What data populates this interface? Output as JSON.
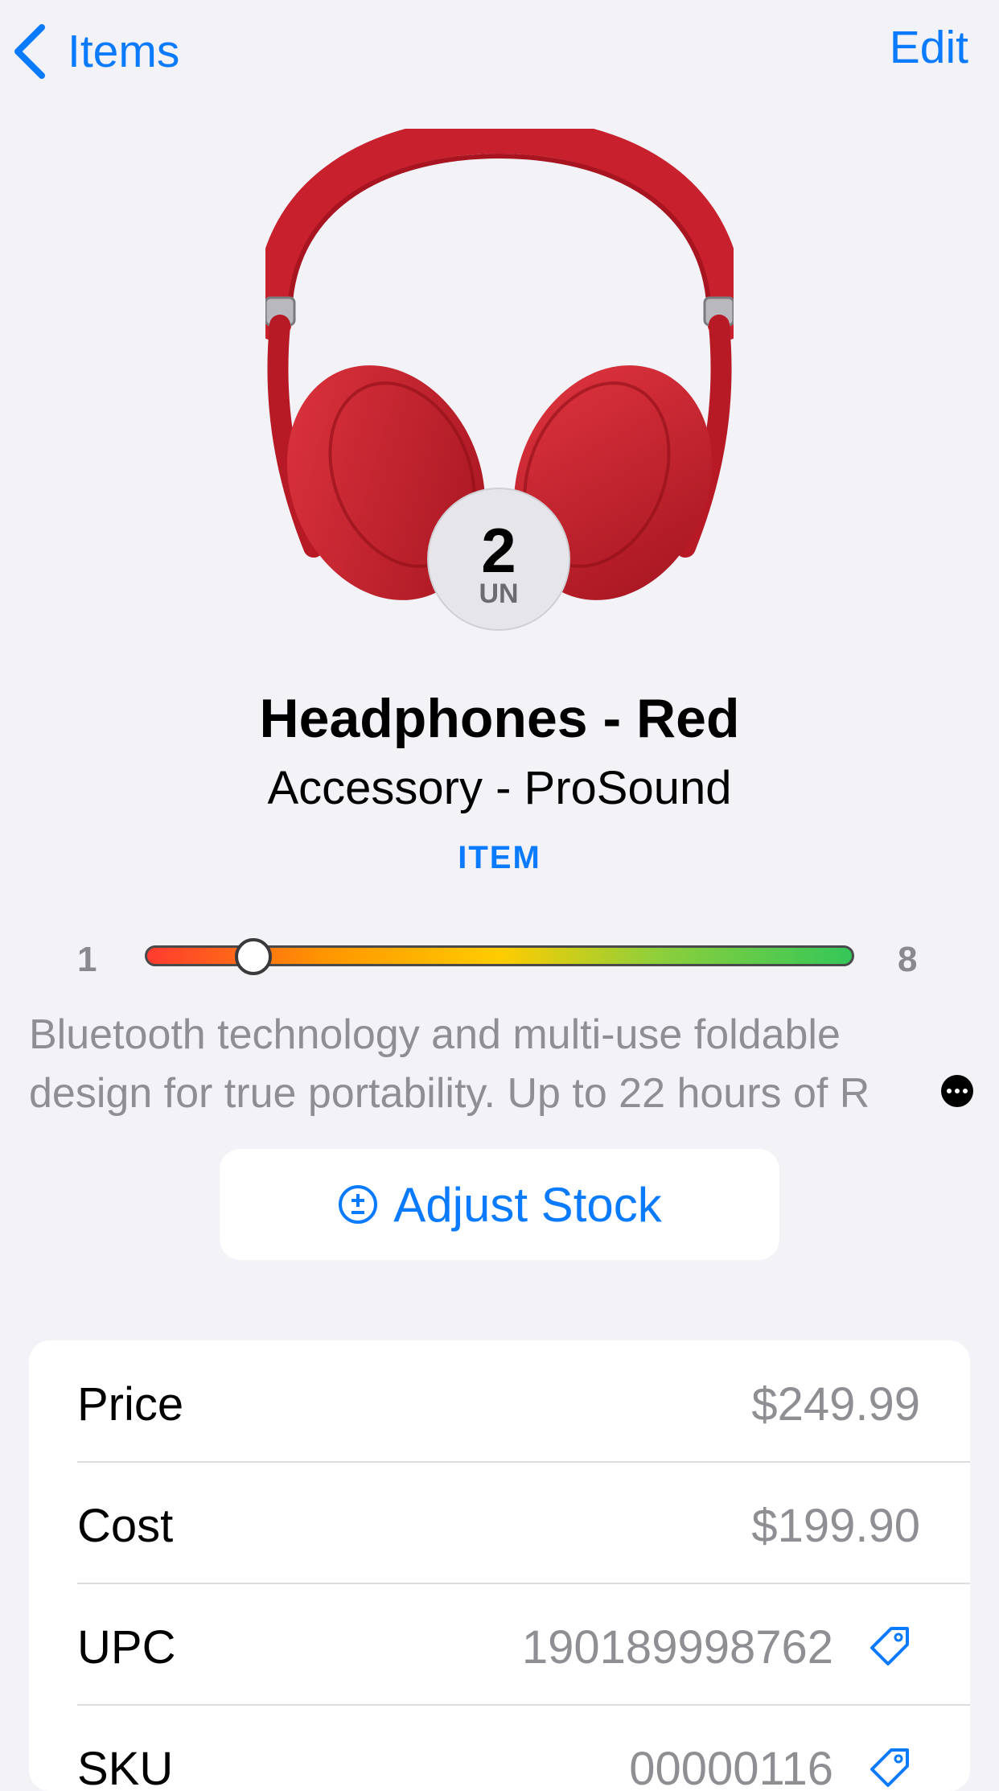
{
  "nav": {
    "back_label": "Items",
    "edit_label": "Edit"
  },
  "product": {
    "stock_qty": "2",
    "stock_unit": "UN",
    "name": "Headphones - Red",
    "category": "Accessory - ProSound",
    "type": "ITEM",
    "image_icon": "headphones-image"
  },
  "stock_slider": {
    "min": "1",
    "max": "8",
    "value": 2
  },
  "description": "Bluetooth technology and multi-use foldable design for true portability.  Up to 22 hours of R",
  "adjust": {
    "label": "Adjust Stock",
    "icon": "plus-minus-circle-icon"
  },
  "details": [
    {
      "label": "Price",
      "value": "$249.99",
      "icon": ""
    },
    {
      "label": "Cost",
      "value": "$199.90",
      "icon": ""
    },
    {
      "label": "UPC",
      "value": "190189998762",
      "icon": "tag-icon"
    },
    {
      "label": "SKU",
      "value": "00000116",
      "icon": "tag-icon"
    }
  ],
  "colors": {
    "accent": "#0a7aff",
    "background": "#f2f2f7",
    "product": "#c8202c"
  }
}
